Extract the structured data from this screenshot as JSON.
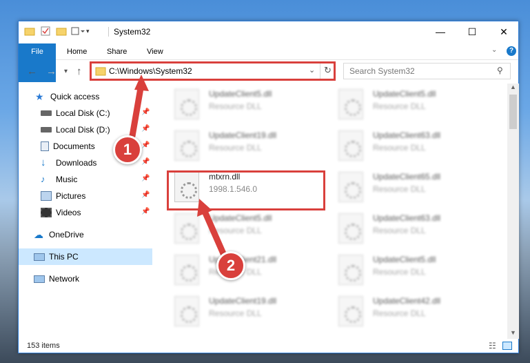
{
  "window": {
    "title": "System32",
    "controls": {
      "minimize": "—",
      "maximize": "☐",
      "close": "✕"
    }
  },
  "ribbon": {
    "tabs": [
      {
        "label": "File"
      },
      {
        "label": "Home"
      },
      {
        "label": "Share"
      },
      {
        "label": "View"
      }
    ],
    "help": "?"
  },
  "address": {
    "path": "C:\\Windows\\System32",
    "search_placeholder": "Search System32"
  },
  "nav_pane": {
    "items": [
      {
        "label": "Quick access",
        "icon": "star-icon"
      },
      {
        "label": "Local Disk (C:)",
        "icon": "drive-icon",
        "pinned": true
      },
      {
        "label": "Local Disk (D:)",
        "icon": "drive-icon",
        "pinned": true
      },
      {
        "label": "Documents",
        "icon": "documents-icon",
        "pinned": true
      },
      {
        "label": "Downloads",
        "icon": "download-icon",
        "pinned": true
      },
      {
        "label": "Music",
        "icon": "music-icon",
        "pinned": true
      },
      {
        "label": "Pictures",
        "icon": "pictures-icon",
        "pinned": true
      },
      {
        "label": "Videos",
        "icon": "videos-icon",
        "pinned": true
      },
      {
        "label": "OneDrive",
        "icon": "cloud-icon"
      },
      {
        "label": "This PC",
        "icon": "computer-icon",
        "selected": true
      },
      {
        "label": "Network",
        "icon": "network-icon"
      }
    ]
  },
  "files": [
    {
      "name": "UpdateClient5.dll",
      "desc": "Resource DLL"
    },
    {
      "name": "UpdateClient5.dll",
      "desc": "Resource DLL"
    },
    {
      "name": "UpdateClient19.dll",
      "desc": "Resource DLL"
    },
    {
      "name": "UpdateClient63.dll",
      "desc": "Resource DLL"
    },
    {
      "name": "mtxrn.dll",
      "desc": "1998.1.546.0"
    },
    {
      "name": "UpdateClient65.dll",
      "desc": "Resource DLL"
    },
    {
      "name": "UpdateClient5.dll",
      "desc": "Resource DLL"
    },
    {
      "name": "UpdateClient63.dll",
      "desc": "Resource DLL"
    },
    {
      "name": "UpdateClient21.dll",
      "desc": "Resource DLL"
    },
    {
      "name": "UpdateClient5.dll",
      "desc": "Resource DLL"
    },
    {
      "name": "UpdateClient19.dll",
      "desc": "Resource DLL"
    },
    {
      "name": "UpdateClient42.dll",
      "desc": "Resource DLL"
    }
  ],
  "status": {
    "count": "153 items"
  },
  "annotations": {
    "step1": "1",
    "step2": "2"
  },
  "colors": {
    "accent": "#1979ca",
    "highlight": "#d9403c",
    "selected": "#cce8ff"
  }
}
